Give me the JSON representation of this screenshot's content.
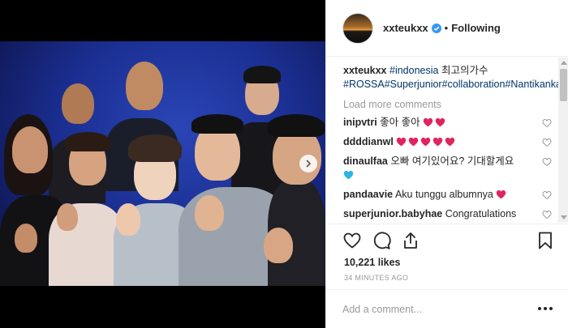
{
  "post": {
    "username": "xxteukxx",
    "follow_status": "Following",
    "separator": "•",
    "caption": {
      "username": "xxteukxx",
      "parts": [
        {
          "text": "#indonesia",
          "tag": true
        },
        {
          "text": " 최고의가수 ",
          "tag": false
        },
        {
          "text": "#ROSSA",
          "tag": true
        },
        {
          "text": "#Superjunior",
          "tag": true
        },
        {
          "text": "#collaboration",
          "tag": true
        },
        {
          "text": "#Nantikankami",
          "tag": true
        },
        {
          "text": "!",
          "tag": false
        }
      ]
    },
    "load_more": "Load more comments",
    "comments": [
      {
        "user": "inipvtri",
        "text": "좋아 좋아",
        "hearts": 2
      },
      {
        "user": "ddddianwl",
        "text": "",
        "hearts": 5
      },
      {
        "user": "dinaulfaa",
        "text": "오빠 여기있어요? 기대할게요",
        "hearts": 0,
        "blue_heart": true
      },
      {
        "user": "pandaavie",
        "text": "Aku tunggu albumnya",
        "hearts": 1
      },
      {
        "user": "superjunior.babyhae",
        "text": "Congratulations",
        "hearts": 0
      }
    ],
    "likes": "10,221 likes",
    "time": "34 MINUTES AGO",
    "comment_placeholder": "Add a comment...",
    "colors": {
      "hashtag": "#003569",
      "verified": "#3897f0",
      "heart_red": "#e0245e",
      "heart_blue": "#2fb3e6",
      "muted": "#999999"
    },
    "icons": [
      "verified-icon",
      "heart-icon",
      "comment-icon",
      "share-icon",
      "bookmark-icon",
      "more-options-icon",
      "carousel-next-icon"
    ]
  }
}
